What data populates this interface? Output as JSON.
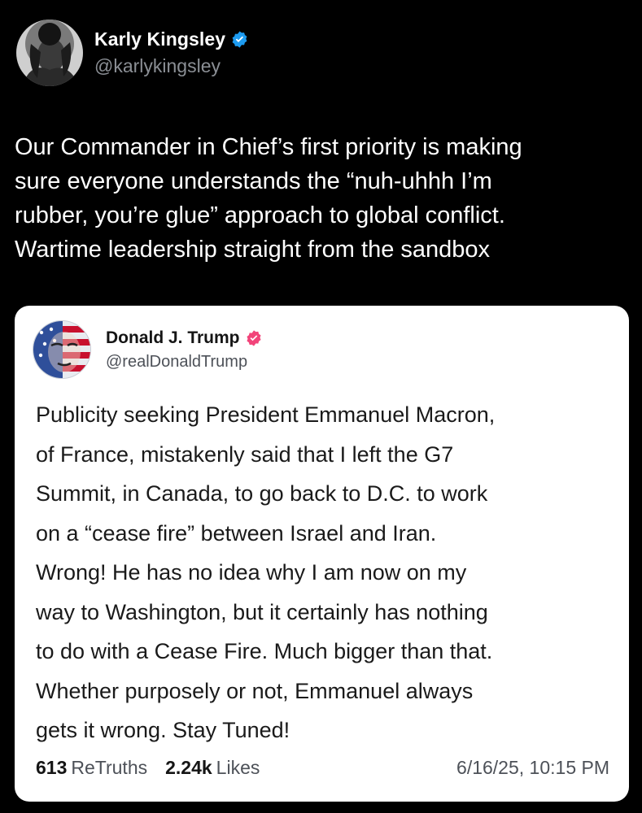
{
  "post": {
    "author": {
      "display_name": "Karly Kingsley",
      "handle": "@karlykingsley",
      "verified_icon": "verified-badge-icon",
      "verified_color": "#1d9bf0"
    },
    "text_lines": [
      "Our Commander in Chief’s first priority is making",
      "sure everyone understands the “nuh-uhhh I’m",
      "rubber, you’re glue” approach to global conflict.",
      "Wartime leadership straight from the sandbox"
    ]
  },
  "quoted": {
    "author": {
      "display_name": "Donald J. Trump",
      "handle": "@realDonaldTrump",
      "verified_icon": "verified-badge-icon",
      "verified_color": "#f2447a"
    },
    "text_lines": [
      "Publicity seeking President Emmanuel Macron,",
      "of France, mistakenly said that I left the G7",
      "Summit, in Canada, to go back to D.C. to work",
      "on a “cease fire” between Israel and Iran.",
      "Wrong! He has no idea why I am now on my",
      "way to Washington, but it certainly has nothing",
      "to do with a Cease Fire. Much bigger than that.",
      "Whether purposely or not, Emmanuel always",
      "gets it wrong. Stay Tuned!"
    ],
    "stats": {
      "retruths_count": "613",
      "retruths_label": "ReTruths",
      "likes_count": "2.24k",
      "likes_label": "Likes"
    },
    "timestamp": "6/16/25, 10:15 PM"
  }
}
